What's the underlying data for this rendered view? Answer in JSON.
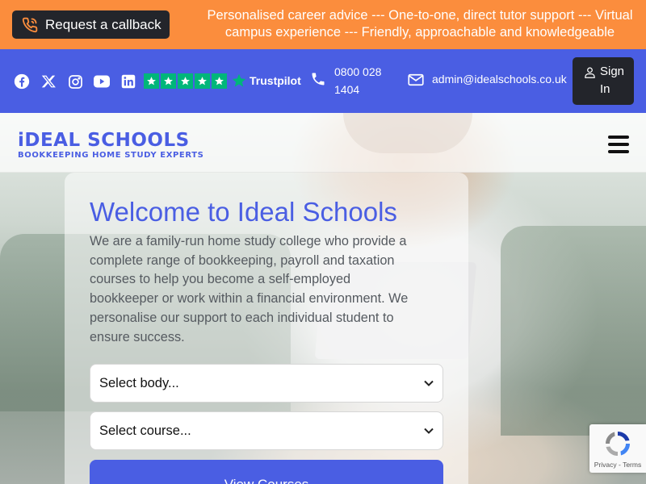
{
  "topbar": {
    "callback_label": "Request a callback",
    "tagline": "Personalised career advice --- One-to-one, direct tutor support --- Virtual campus experience --- Friendly, approachable and knowledgeable"
  },
  "contact": {
    "social_icons": [
      "facebook-icon",
      "x-icon",
      "instagram-icon",
      "youtube-icon",
      "linkedin-icon"
    ],
    "trustpilot_label": "Trustpilot",
    "phone": "0800 028 1404",
    "email": "admin@idealschools.co.uk",
    "signin_label": "Sign In"
  },
  "header": {
    "logo_title": "iDEAL SCHOOLS",
    "logo_subtitle": "BOOKKEEPING HOME STUDY EXPERTS"
  },
  "hero": {
    "title": "Welcome to Ideal Schools",
    "intro": "We are a family-run home study college who provide a complete range of bookkeeping, payroll and taxation courses to help you become a self-employed bookkeeper or work within a financial environment. We personalise our support to each individual student to ensure success.",
    "select_body": "Select body...",
    "select_course": "Select course...",
    "view_button": "View Courses"
  },
  "recaptcha": {
    "links": "Privacy - Terms"
  },
  "colors": {
    "orange": "#fb8d3d",
    "blue": "#4a5ee3",
    "dark": "#23252b",
    "trustpilot_green": "#00b67a"
  }
}
